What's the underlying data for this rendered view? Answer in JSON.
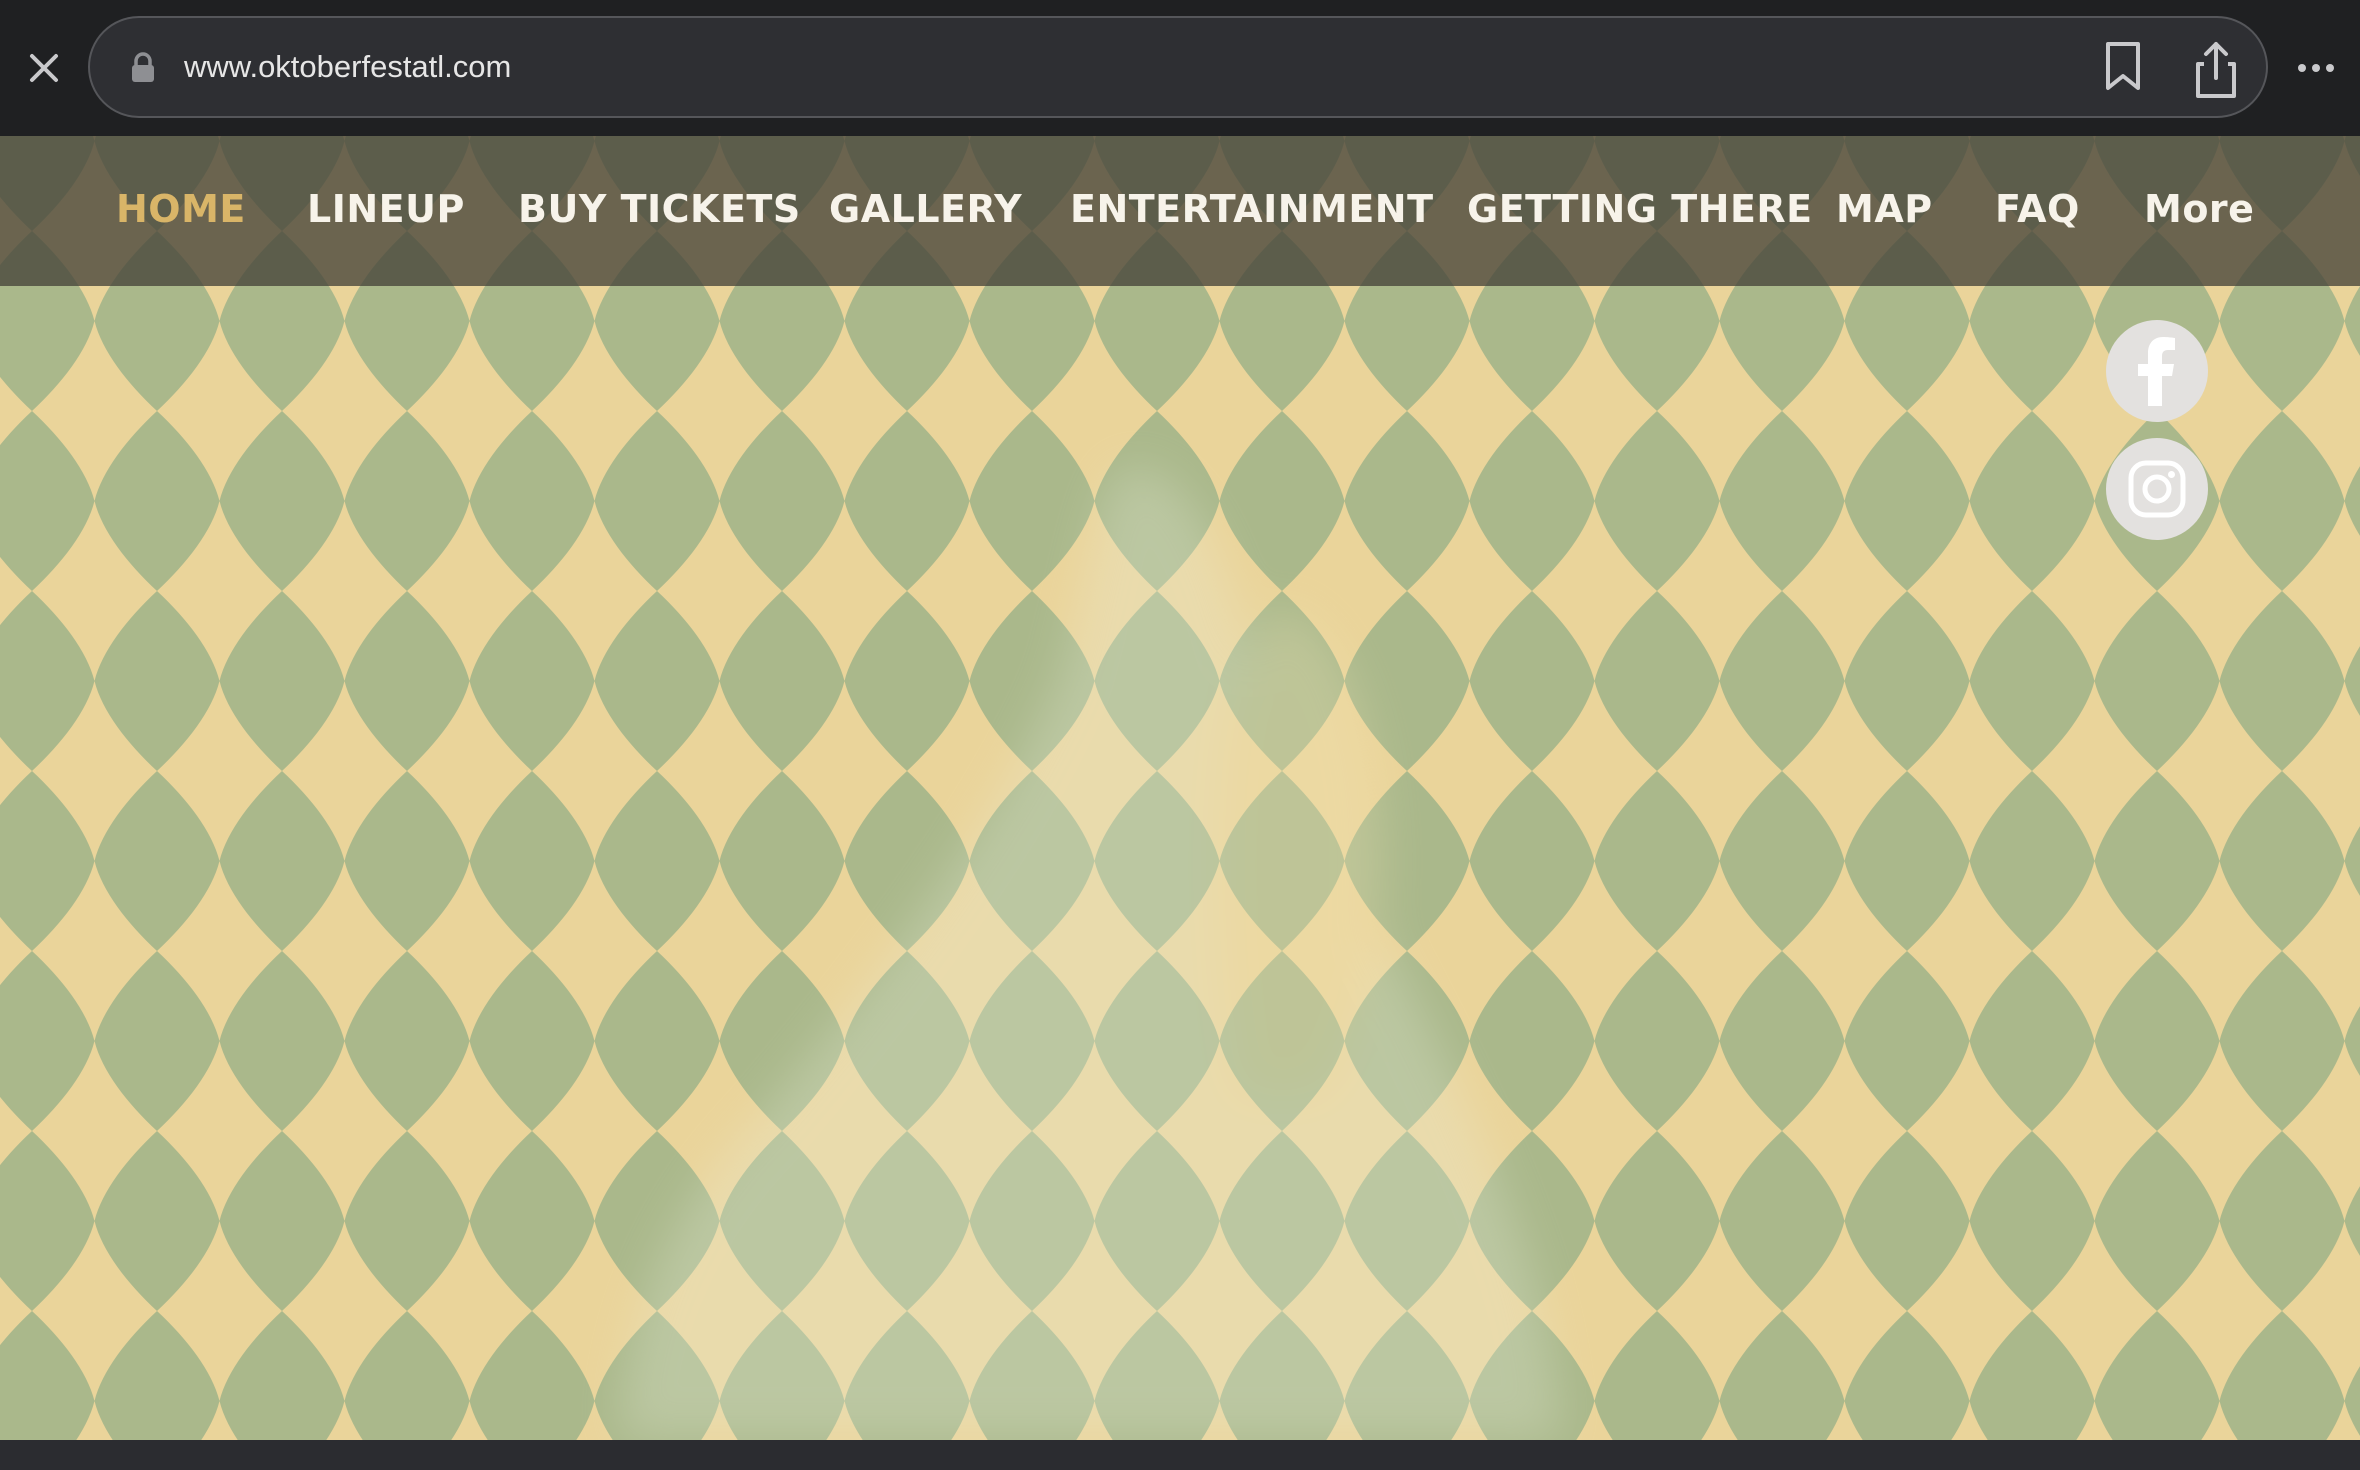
{
  "browser": {
    "url": "www.oktoberfestatl.com",
    "icons": [
      "close-icon",
      "lock-icon",
      "bookmark-icon",
      "share-icon",
      "more-icon"
    ]
  },
  "nav": {
    "items": [
      {
        "label": "HOME",
        "active": true
      },
      {
        "label": "LINEUP",
        "active": false
      },
      {
        "label": "BUY TICKETS",
        "active": false
      },
      {
        "label": "GALLERY",
        "active": false
      },
      {
        "label": "ENTERTAINMENT",
        "active": false
      },
      {
        "label": "GETTING THERE",
        "active": false
      },
      {
        "label": "MAP",
        "active": false
      },
      {
        "label": "FAQ",
        "active": false
      },
      {
        "label": "More",
        "active": false
      }
    ]
  },
  "social": {
    "icons": [
      "facebook-icon",
      "instagram-icon"
    ]
  },
  "colors": {
    "active_nav": "#d9b568",
    "nav_text": "#f7f3ea",
    "diamond_yellow": "#ead49a",
    "diamond_green": "#a9b68a"
  }
}
